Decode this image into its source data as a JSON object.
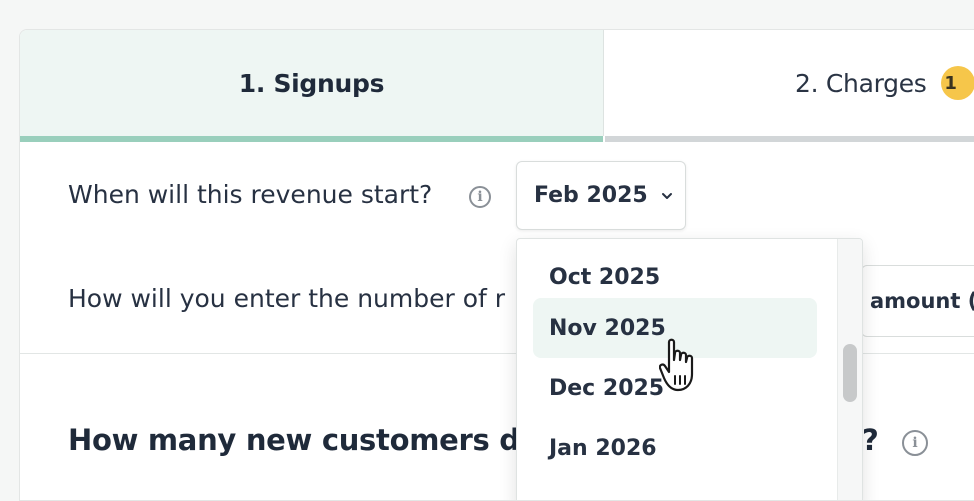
{
  "tabs": [
    {
      "label": "1. Signups",
      "active": true
    },
    {
      "label": "2. Charges",
      "badge": "1"
    }
  ],
  "questions": {
    "start_label": "When will this revenue start?",
    "start_value": "Feb 2025",
    "entry_label": "How will you enter the number of r",
    "entry_value": "amount (S",
    "heading_prefix": "How many new customers do",
    "heading_suffix": "?"
  },
  "dropdown": {
    "options": [
      "Oct 2025",
      "Nov 2025",
      "Dec 2025",
      "Jan 2026"
    ],
    "highlighted": "Nov 2025"
  },
  "colors": {
    "accent": "#99cfbc",
    "active_tab_bg": "#eef6f3",
    "badge": "#f6c64a"
  },
  "icons": {
    "info": "info-icon",
    "chevron": "chevron-down-icon",
    "cursor": "hand-pointer-icon"
  }
}
